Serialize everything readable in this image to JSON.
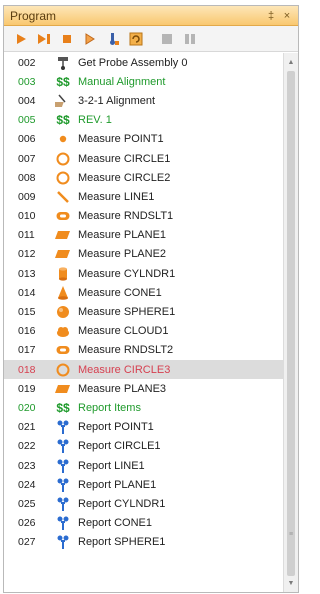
{
  "panel": {
    "title": "Program",
    "pin_glyph": "‡",
    "close_glyph": "×"
  },
  "toolbar": {
    "tools": [
      {
        "icon": "play-icon"
      },
      {
        "icon": "play-to-end-icon"
      },
      {
        "icon": "stop-icon"
      },
      {
        "icon": "step-icon"
      },
      {
        "icon": "probe-icon"
      },
      {
        "icon": "refresh-icon"
      },
      {
        "icon": "disabled-stop-icon"
      },
      {
        "icon": "disabled-step-icon"
      }
    ]
  },
  "colors": {
    "header_start": "#fde6b8",
    "header_end": "#f9c870",
    "green_text": "#1f9a2c",
    "red_text": "#d64050",
    "selected_bg": "#dcdcdc",
    "orange_icon": "#f08c1e",
    "blue_icon": "#2b6cd0"
  },
  "steps": [
    {
      "num": "002",
      "label": "Get Probe Assembly 0",
      "icon": "probe-assembly-icon",
      "style": "normal"
    },
    {
      "num": "003",
      "label": "Manual Alignment",
      "icon": "dollar-icon",
      "style": "green"
    },
    {
      "num": "004",
      "label": "3-2-1 Alignment",
      "icon": "alignment-icon",
      "style": "normal"
    },
    {
      "num": "005",
      "label": "REV. 1",
      "icon": "dollar-icon",
      "style": "green"
    },
    {
      "num": "006",
      "label": "Measure POINT1",
      "icon": "point-icon",
      "style": "normal"
    },
    {
      "num": "007",
      "label": "Measure CIRCLE1",
      "icon": "circle-icon",
      "style": "normal"
    },
    {
      "num": "008",
      "label": "Measure CIRCLE2",
      "icon": "circle-icon",
      "style": "normal"
    },
    {
      "num": "009",
      "label": "Measure LINE1",
      "icon": "line-icon",
      "style": "normal"
    },
    {
      "num": "010",
      "label": "Measure RNDSLT1",
      "icon": "slot-icon",
      "style": "normal"
    },
    {
      "num": "011",
      "label": "Measure PLANE1",
      "icon": "plane-icon",
      "style": "normal"
    },
    {
      "num": "012",
      "label": "Measure PLANE2",
      "icon": "plane-icon",
      "style": "normal"
    },
    {
      "num": "013",
      "label": "Measure CYLNDR1",
      "icon": "cylinder-icon",
      "style": "normal"
    },
    {
      "num": "014",
      "label": "Measure CONE1",
      "icon": "cone-icon",
      "style": "normal"
    },
    {
      "num": "015",
      "label": "Measure SPHERE1",
      "icon": "sphere-icon",
      "style": "normal"
    },
    {
      "num": "016",
      "label": "Measure CLOUD1",
      "icon": "cloud-icon",
      "style": "normal"
    },
    {
      "num": "017",
      "label": "Measure RNDSLT2",
      "icon": "slot-icon",
      "style": "normal"
    },
    {
      "num": "018",
      "label": "Measure CIRCLE3",
      "icon": "circle-icon",
      "style": "red",
      "selected": true
    },
    {
      "num": "019",
      "label": "Measure PLANE3",
      "icon": "plane-icon",
      "style": "normal"
    },
    {
      "num": "020",
      "label": "Report Items",
      "icon": "dollar-icon",
      "style": "green"
    },
    {
      "num": "021",
      "label": "Report POINT1",
      "icon": "report-icon",
      "style": "normal"
    },
    {
      "num": "022",
      "label": "Report CIRCLE1",
      "icon": "report-icon",
      "style": "normal"
    },
    {
      "num": "023",
      "label": "Report LINE1",
      "icon": "report-icon",
      "style": "normal"
    },
    {
      "num": "024",
      "label": "Report PLANE1",
      "icon": "report-icon",
      "style": "normal"
    },
    {
      "num": "025",
      "label": "Report CYLNDR1",
      "icon": "report-icon",
      "style": "normal"
    },
    {
      "num": "026",
      "label": "Report CONE1",
      "icon": "report-icon",
      "style": "normal"
    },
    {
      "num": "027",
      "label": "Report SPHERE1",
      "icon": "report-icon",
      "style": "normal"
    }
  ]
}
